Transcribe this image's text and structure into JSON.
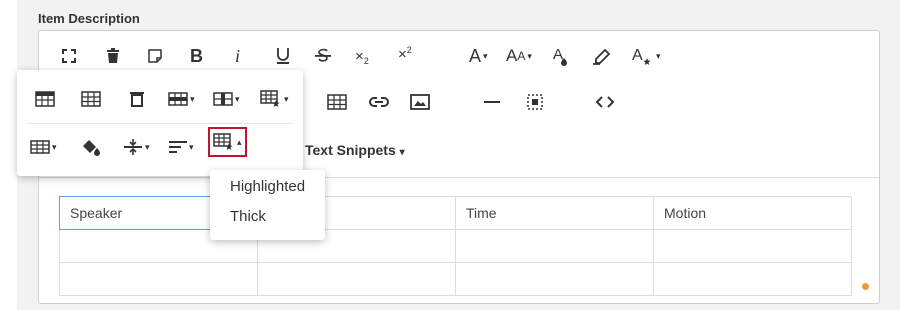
{
  "field": {
    "label": "Item Description"
  },
  "toolbar": {
    "icons": [
      "fullscreen-icon",
      "trash-icon",
      "paste-icon",
      "bold-icon",
      "italic-icon",
      "underline-icon",
      "strikethrough-icon",
      "subscript-icon",
      "superscript-icon",
      "font-size-icon",
      "font-family-icon",
      "text-color-icon",
      "highlight-icon",
      "text-style-icon",
      "insert-table-icon",
      "insert-link-icon",
      "insert-image-icon",
      "horizontal-line-icon",
      "select-all-icon",
      "code-view-icon"
    ],
    "snippets_label": "Text Snippets"
  },
  "table_popup": {
    "icons": [
      "table-header-icon",
      "table-footer-icon",
      "remove-table-icon",
      "table-rows-icon",
      "table-columns-icon",
      "table-style-icon",
      "cell-icon",
      "cell-background-icon",
      "vertical-align-icon",
      "horizontal-align-icon",
      "cell-style-icon"
    ],
    "cell_style_options": [
      "Highlighted",
      "Thick"
    ]
  },
  "table": {
    "headers": [
      "Speaker",
      "",
      "Time",
      "Motion"
    ],
    "rows": [
      [
        "",
        "",
        "",
        ""
      ],
      [
        "",
        "",
        "",
        ""
      ]
    ]
  },
  "colors": {
    "accent_border": "#c0142d",
    "focus_border": "#6b9ad6",
    "indicator": "#f39a3c"
  }
}
